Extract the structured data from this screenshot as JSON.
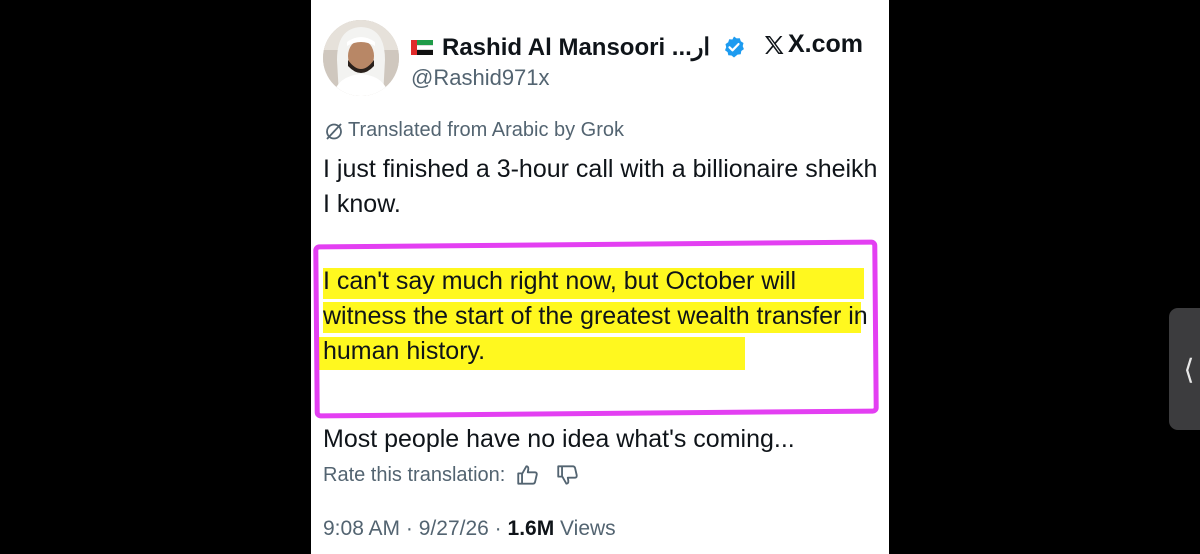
{
  "tweet": {
    "author_name": "Rashid Al Mansoori ...ار",
    "handle": "@Rashid971x",
    "site": "X.com",
    "translation_note": "Translated from Arabic by Grok",
    "paragraph1": "I just finished a 3-hour call with a billionaire sheikh I know.",
    "paragraph2": "I can't say much right now, but October will witness the start of the greatest wealth transfer in human history.",
    "paragraph3": "Most people have no idea what's coming...",
    "rate_label": "Rate this translation:",
    "time": "9:08 AM",
    "date": "9/27/26",
    "separator": "·",
    "views_count": "1.6M",
    "views_label": "Views"
  },
  "colors": {
    "highlight": "#fff700",
    "annotation_box": "#e33ff2",
    "verified_badge": "#1d9bf0",
    "muted_text": "#536471"
  },
  "icons": {
    "side_handle": "chevron-left-icon",
    "thumbs_up": "thumbs-up-icon",
    "thumbs_down": "thumbs-down-icon"
  }
}
